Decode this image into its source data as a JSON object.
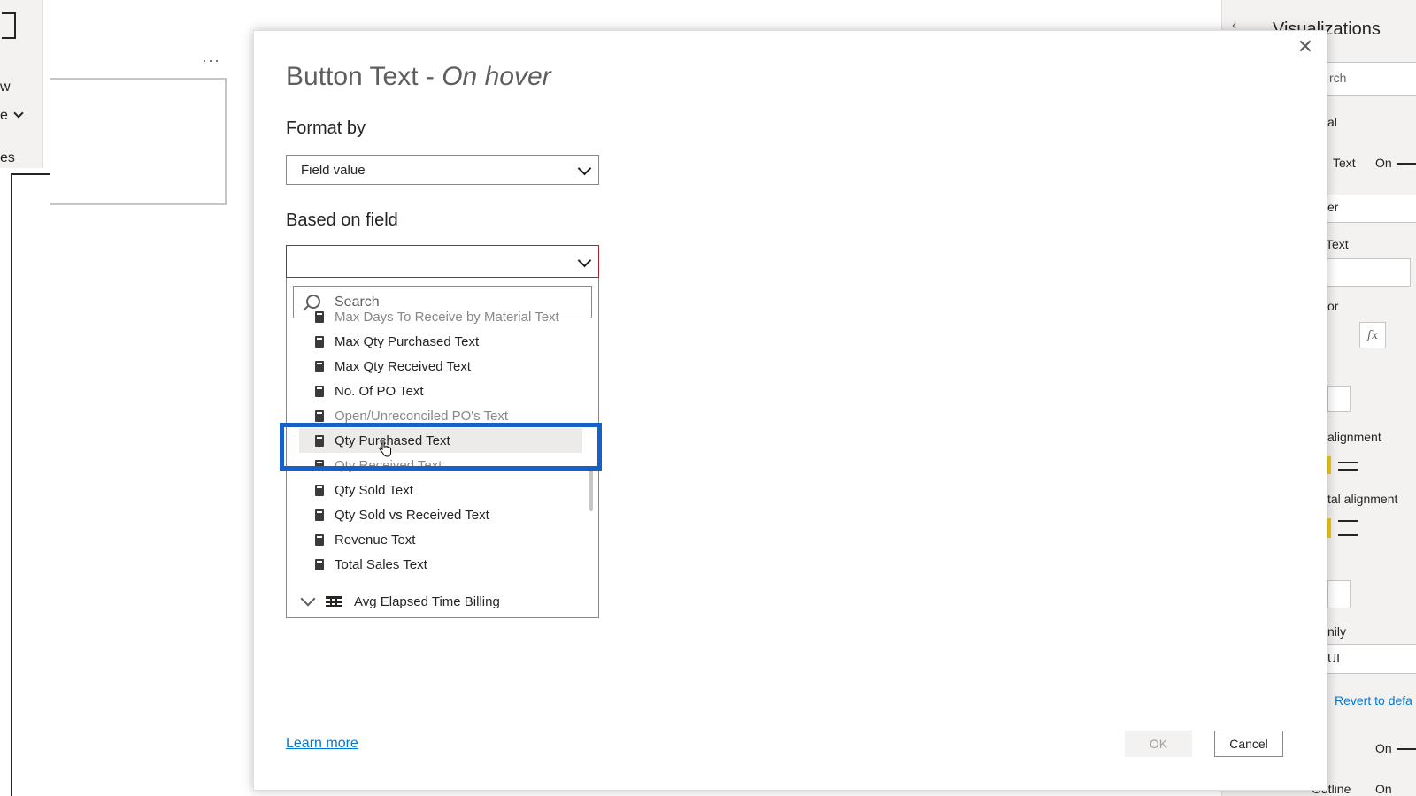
{
  "ribbon": {
    "fragments": [
      "w",
      "e",
      "es"
    ]
  },
  "visualizations_pane": {
    "title": "Visualizations",
    "search_placeholder": "rch",
    "fragments": [
      {
        "text": "al"
      },
      {
        "text": "Text"
      },
      {
        "text": "On"
      },
      {
        "text": "er"
      },
      {
        "text": "Text"
      },
      {
        "text": "or"
      },
      {
        "text": "alignment"
      },
      {
        "text": "tal alignment"
      },
      {
        "text": "nily"
      },
      {
        "text": "UI"
      },
      {
        "text": "Revert to defa"
      },
      {
        "text": "On"
      },
      {
        "text": "Outline"
      },
      {
        "text": "On"
      }
    ],
    "fx_label": "fx"
  },
  "dialog": {
    "title_main": "Button Text - ",
    "title_state": "On hover",
    "format_by_label": "Format by",
    "format_by_value": "Field value",
    "based_on_label": "Based on field",
    "search_placeholder": "Search",
    "fields": [
      {
        "label": "Max Days To Receive by Material Text",
        "state": "faded"
      },
      {
        "label": "Max Qty Purchased Text",
        "state": "normal"
      },
      {
        "label": "Max Qty Received Text",
        "state": "normal"
      },
      {
        "label": "No. Of PO Text",
        "state": "normal"
      },
      {
        "label": "Open/Unreconciled PO's Text",
        "state": "faded"
      },
      {
        "label": "Qty Purchased Text",
        "state": "hover"
      },
      {
        "label": "Qty Received Text",
        "state": "faded"
      },
      {
        "label": "Qty Sold Text",
        "state": "normal"
      },
      {
        "label": "Qty Sold vs Received Text",
        "state": "normal"
      },
      {
        "label": "Revenue Text",
        "state": "normal"
      },
      {
        "label": "Total Sales Text",
        "state": "normal"
      }
    ],
    "table_group": "Avg Elapsed Time Billing",
    "learn_more": "Learn more",
    "ok_label": "OK",
    "cancel_label": "Cancel"
  },
  "colors": {
    "accent": "#0078d4",
    "highlight_box": "#1560c9",
    "error_border": "#a4262c"
  }
}
